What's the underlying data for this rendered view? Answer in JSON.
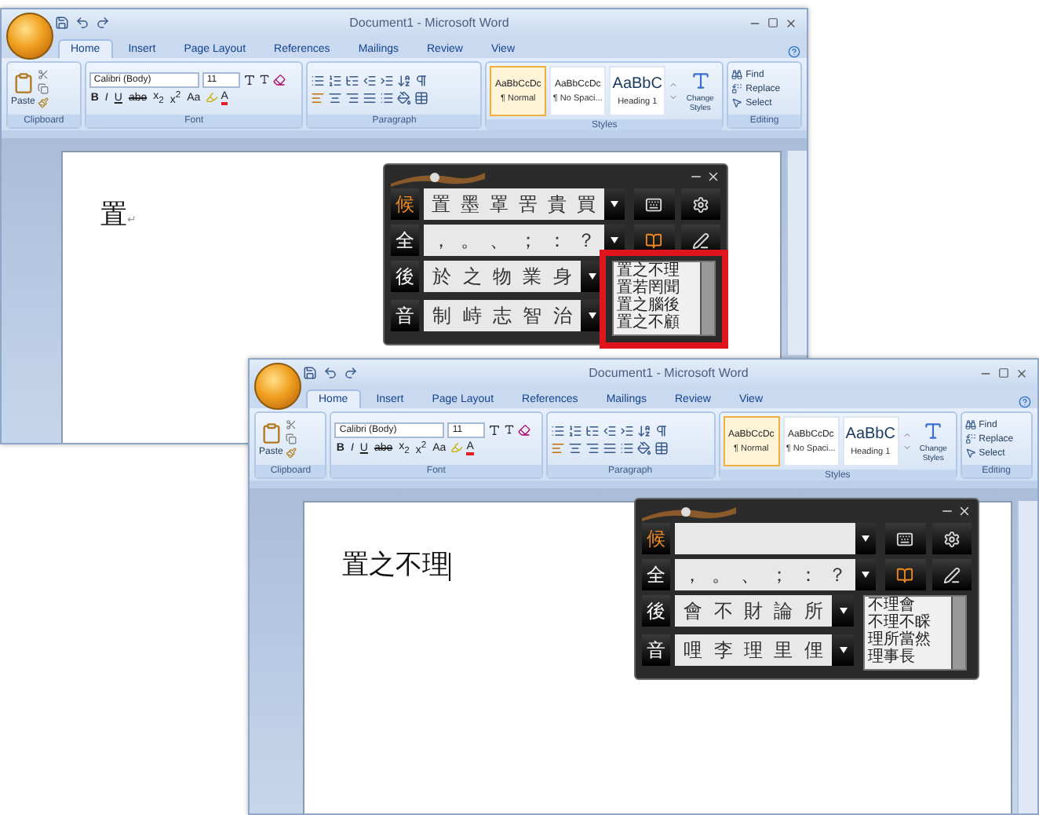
{
  "windows": [
    {
      "title": "Document1 - Microsoft Word",
      "tabs": [
        {
          "label": "Home",
          "selected": true
        },
        {
          "label": "Insert",
          "selected": false
        },
        {
          "label": "Page Layout",
          "selected": false
        },
        {
          "label": "References",
          "selected": false
        },
        {
          "label": "Mailings",
          "selected": false
        },
        {
          "label": "Review",
          "selected": false
        },
        {
          "label": "View",
          "selected": false
        }
      ],
      "ribbon": {
        "paste": "Paste",
        "font_name": "Calibri (Body)",
        "font_size": "11",
        "font_buttons": [
          "B",
          "I",
          "U",
          "abe",
          "x$_{2}$",
          "x$^{2}$",
          "Aa"
        ],
        "font_color": "A",
        "styles": [
          {
            "preview": "AaBbCcDc",
            "name": "¶ Normal",
            "selected": true,
            "kind": "body"
          },
          {
            "preview": "AaBbCcDc",
            "name": "¶ No Spaci...",
            "selected": false,
            "kind": "body"
          },
          {
            "preview": "AaBbC",
            "name": "Heading 1",
            "selected": false,
            "kind": "heading"
          }
        ],
        "change_styles": "Change Styles",
        "editing": [
          "Find",
          "Replace",
          "Select"
        ],
        "groups": [
          "Clipboard",
          "Font",
          "Paragraph",
          "Styles",
          "Editing"
        ]
      },
      "document": {
        "text": "置",
        "paragraph_mark": "↵",
        "cursor": false
      },
      "ime": {
        "top_rows": [
          {
            "label": "候",
            "selected": true,
            "items": [
              "置",
              "墨",
              "罩",
              "罟",
              "貴",
              "買"
            ]
          },
          {
            "label": "全",
            "selected": false,
            "items": [
              "，",
              "。",
              "、",
              "；",
              "：",
              "？"
            ]
          }
        ],
        "bottom_rows": [
          {
            "label": "後",
            "selected": false,
            "items": [
              "於",
              "之",
              "物",
              "業",
              "身"
            ]
          },
          {
            "label": "音",
            "selected": false,
            "items": [
              "制",
              "峙",
              "志",
              "智",
              "治"
            ]
          }
        ],
        "phrases": [
          "置之不理",
          "置若罔聞",
          "置之腦後",
          "置之不顧"
        ],
        "phrases_annotated": true
      }
    },
    {
      "title": "Document1 - Microsoft Word",
      "tabs": [
        {
          "label": "Home",
          "selected": true
        },
        {
          "label": "Insert",
          "selected": false
        },
        {
          "label": "Page Layout",
          "selected": false
        },
        {
          "label": "References",
          "selected": false
        },
        {
          "label": "Mailings",
          "selected": false
        },
        {
          "label": "Review",
          "selected": false
        },
        {
          "label": "View",
          "selected": false
        }
      ],
      "ribbon": {
        "paste": "Paste",
        "font_name": "Calibri (Body)",
        "font_size": "11",
        "font_buttons": [
          "B",
          "I",
          "U",
          "abe",
          "x$_{2}$",
          "x$^{2}$",
          "Aa"
        ],
        "font_color": "A",
        "styles": [
          {
            "preview": "AaBbCcDc",
            "name": "¶ Normal",
            "selected": true,
            "kind": "body"
          },
          {
            "preview": "AaBbCcDc",
            "name": "¶ No Spaci...",
            "selected": false,
            "kind": "body"
          },
          {
            "preview": "AaBbC",
            "name": "Heading 1",
            "selected": false,
            "kind": "heading"
          }
        ],
        "change_styles": "Change Styles",
        "editing": [
          "Find",
          "Replace",
          "Select"
        ],
        "groups": [
          "Clipboard",
          "Font",
          "Paragraph",
          "Styles",
          "Editing"
        ]
      },
      "document": {
        "text": "置之不理",
        "cursor": true
      },
      "ime": {
        "top_rows": [
          {
            "label": "候",
            "selected": true
          },
          {
            "label": "全",
            "selected": false,
            "items": [
              "，",
              "。",
              "、",
              "；",
              "：",
              "？"
            ]
          }
        ],
        "bottom_rows": [
          {
            "label": "後",
            "selected": false,
            "items": [
              "會",
              "不",
              "財",
              "論",
              "所"
            ]
          },
          {
            "label": "音",
            "selected": false,
            "items": [
              "哩",
              "李",
              "理",
              "里",
              "俚"
            ]
          }
        ],
        "phrases": [
          "不理會",
          "不理不睬",
          "理所當然",
          "理事長"
        ],
        "phrases_annotated": false
      }
    }
  ]
}
